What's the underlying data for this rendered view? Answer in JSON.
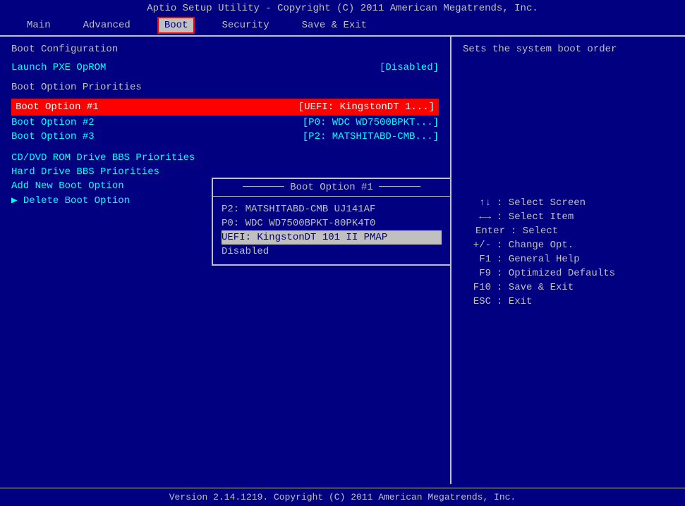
{
  "title_bar": {
    "text": "Aptio Setup Utility - Copyright (C) 2011 American Megatrends, Inc."
  },
  "menu": {
    "items": [
      {
        "id": "main",
        "label": "Main",
        "active": false
      },
      {
        "id": "advanced",
        "label": "Advanced",
        "active": false
      },
      {
        "id": "boot",
        "label": "Boot",
        "active": true
      },
      {
        "id": "security",
        "label": "Security",
        "active": false
      },
      {
        "id": "save-exit",
        "label": "Save & Exit",
        "active": false
      }
    ]
  },
  "left_panel": {
    "section1_title": "Boot Configuration",
    "launch_pxe_label": "Launch PXE OpROM",
    "launch_pxe_value": "[Disabled]",
    "section2_title": "Boot Option Priorities",
    "boot_options": [
      {
        "label": "Boot Option #1",
        "value": "[UEFI: KingstonDT 1...]",
        "selected": true
      },
      {
        "label": "Boot Option #2",
        "value": "[P0: WDC WD7500BPKT...]"
      },
      {
        "label": "Boot Option #3",
        "value": "[P2: MATSHITABD-CMB...]"
      }
    ],
    "menu_links": [
      {
        "label": "CD/DVD ROM Drive BBS Priorities",
        "arrow": false
      },
      {
        "label": "Hard Drive BBS Priorities",
        "arrow": false
      },
      {
        "label": "Add New Boot Option",
        "arrow": false
      },
      {
        "label": "Delete Boot Option",
        "arrow": true
      }
    ]
  },
  "popup": {
    "title": "Boot Option #1",
    "options": [
      {
        "label": "P2: MATSHITABD-CMB UJ141AF",
        "highlighted": false
      },
      {
        "label": "P0: WDC WD7500BPKT-80PK4T0",
        "highlighted": false
      },
      {
        "label": "UEFI: KingstonDT 101 II PMAP",
        "highlighted": true
      },
      {
        "label": "Disabled",
        "highlighted": false
      }
    ]
  },
  "right_panel": {
    "help_text": "Sets the system boot order",
    "key_helps": [
      {
        "key": "↑↓",
        "desc": ": Select Screen"
      },
      {
        "key": "←→",
        "desc": ": Select Item"
      },
      {
        "key": "Enter",
        "desc": ": Select"
      },
      {
        "key": "+/-",
        "desc": ": Change Opt."
      },
      {
        "key": "F1",
        "desc": ": General Help"
      },
      {
        "key": "F9",
        "desc": ": Optimized Defaults"
      },
      {
        "key": "F10",
        "desc": ": Save & Exit"
      },
      {
        "key": "ESC",
        "desc": ": Exit"
      }
    ]
  },
  "bottom_bar": {
    "text": "Version 2.14.1219. Copyright (C) 2011 American Megatrends, Inc."
  }
}
